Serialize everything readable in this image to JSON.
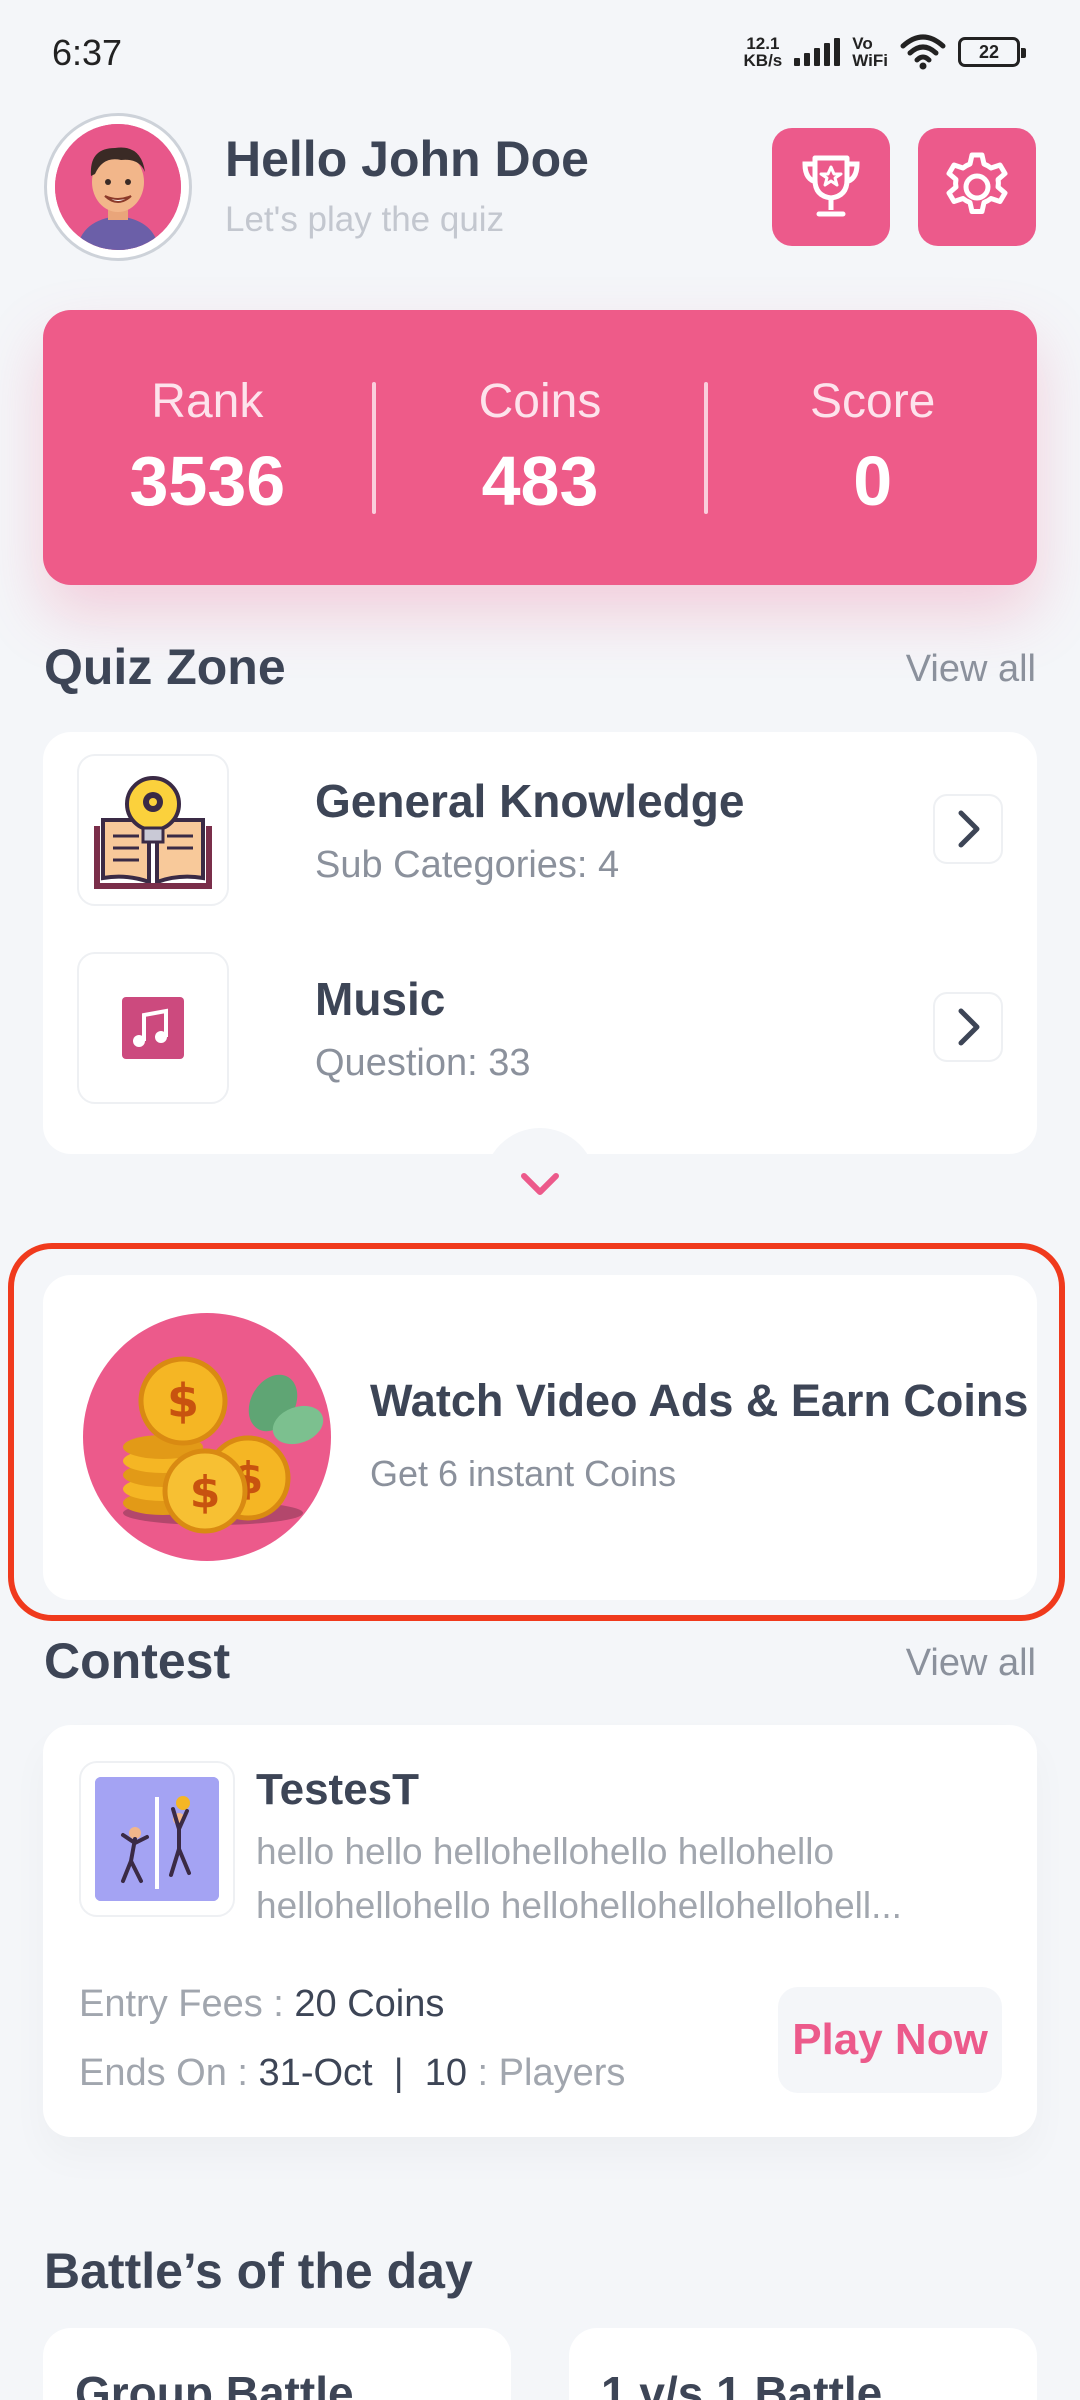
{
  "status_bar": {
    "time": "6:37",
    "net_speed_value": "12.1",
    "net_speed_unit": "KB/s",
    "vo_label": "Vo",
    "wifi_label": "WiFi",
    "battery": "22"
  },
  "header": {
    "greeting": "Hello John Doe",
    "subtitle": "Let's play the quiz",
    "trophy_icon": "trophy-icon",
    "settings_icon": "gear-icon"
  },
  "stats": [
    {
      "label": "Rank",
      "value": "3536"
    },
    {
      "label": "Coins",
      "value": "483"
    },
    {
      "label": "Score",
      "value": "0"
    }
  ],
  "quiz_zone": {
    "title": "Quiz Zone",
    "view_all": "View all",
    "items": [
      {
        "name": "General Knowledge",
        "sub": "Sub Categories: 4",
        "icon": "book-lightbulb-icon"
      },
      {
        "name": "Music",
        "sub": "Question: 33",
        "icon": "music-note-icon"
      }
    ]
  },
  "ads": {
    "title": "Watch Video Ads & Earn Coins",
    "subtitle": "Get 6 instant Coins",
    "icon": "coins-icon",
    "highlight_color": "#f03a1d"
  },
  "contest": {
    "title": "Contest",
    "view_all": "View all",
    "name": "TestesT",
    "desc_line1": "hello hello hellohellohello hellohello",
    "desc_line2": "hellohellohello  hellohellohellohellohell...",
    "entry_label": "Entry Fees : ",
    "entry_value": "20 Coins",
    "ends_label": "Ends On : ",
    "ends_value": "31-Oct",
    "separator": "|",
    "players_value": "10",
    "players_label": " : Players",
    "play_button": "Play Now"
  },
  "battles": {
    "title": "Battle’s of the day",
    "items": [
      "Group Battle",
      "1 v/s 1 Battle"
    ]
  },
  "colors": {
    "accent": "#ec5a8b",
    "background": "#f4f6f9",
    "text": "#3d4556"
  }
}
